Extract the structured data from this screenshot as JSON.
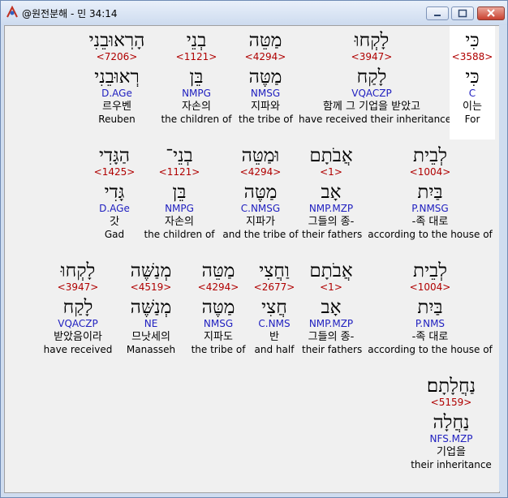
{
  "window": {
    "title": "@원전분해 - 민 34:14"
  },
  "rows": [
    [
      {
        "heb": "הָרֽאוּבֵנִי",
        "strong": "<7206>",
        "lex": "רְאוּבֵנִי",
        "morph": "D.AGe",
        "kor": "르우벤",
        "eng": "Reuben"
      },
      {
        "heb": "בְנֵי",
        "strong": "<1121>",
        "lex": "בֵּן",
        "morph": "NMPG",
        "kor": "자손의",
        "eng": "the children of"
      },
      {
        "heb": "מַטֵּה",
        "strong": "<4294>",
        "lex": "מַטֶּה",
        "morph": "NMSG",
        "kor": "지파와",
        "eng": "the tribe of"
      },
      {
        "heb": "לָקְחוּ",
        "strong": "<3947>",
        "lex": "לָקַח",
        "morph": "VQACZP",
        "kor": "함께 그 기업을 받았고",
        "eng": "have received their inheritance"
      },
      {
        "heb": "כִּי",
        "strong": "<3588>",
        "lex": "כִּי",
        "morph": "C",
        "kor": "이는",
        "eng": "For"
      }
    ],
    [
      {
        "heb": "הַגָּדִי",
        "strong": "<1425>",
        "lex": "גָּדִי",
        "morph": "D.AGe",
        "kor": "갓",
        "eng": "Gad"
      },
      {
        "heb": "בְנֵי־",
        "strong": "<1121>",
        "lex": "בֵּן",
        "morph": "NMPG",
        "kor": "자손의",
        "eng": "the children of"
      },
      {
        "heb": "וּמַטֵּה",
        "strong": "<4294>",
        "lex": "מַטֶּה",
        "morph": "C.NMSG",
        "kor": "지파가",
        "eng": "and the tribe of"
      },
      {
        "heb": "אֲבֹתָם",
        "strong": "<1>",
        "lex": "אָב",
        "morph": "NMP.MZP",
        "kor": "그들의 종-",
        "eng": "their fathers"
      },
      {
        "heb": "לְבֵית",
        "strong": "<1004>",
        "lex": "בַּיִת",
        "morph": "P.NMSG",
        "kor": "-족 대로",
        "eng": "according to the house of"
      }
    ],
    [
      {
        "heb": "לָקְחוּ",
        "strong": "<3947>",
        "lex": "לָקַח",
        "morph": "VQACZP",
        "kor": "받았음이라",
        "eng": "have received"
      },
      {
        "heb": "מְנַשֶּׁה",
        "strong": "<4519>",
        "lex": "מְנַשֶּׁה",
        "morph": "NE",
        "kor": "므낫세의",
        "eng": "Manasseh"
      },
      {
        "heb": "מַטֵּה",
        "strong": "<4294>",
        "lex": "מַטֶּה",
        "morph": "NMSG",
        "kor": "지파도",
        "eng": "the tribe of"
      },
      {
        "heb": "וַחֲצִי",
        "strong": "<2677>",
        "lex": "חֲצִי",
        "morph": "C.NMS",
        "kor": "반",
        "eng": "and half"
      },
      {
        "heb": "אֲבֹתָם",
        "strong": "<1>",
        "lex": "אָב",
        "morph": "NMP.MZP",
        "kor": "그들의 종-",
        "eng": "their fathers"
      },
      {
        "heb": "לְבֵית",
        "strong": "<1004>",
        "lex": "בַּיִת",
        "morph": "P.NMS",
        "kor": "-족 대로",
        "eng": "according to the house of"
      }
    ],
    [
      {
        "heb": "נַחֲלָתָם׃",
        "strong": "<5159>",
        "lex": "נַחֲלָה",
        "morph": "NFS.MZP",
        "kor": "기업을",
        "eng": "their inheritance"
      }
    ]
  ]
}
